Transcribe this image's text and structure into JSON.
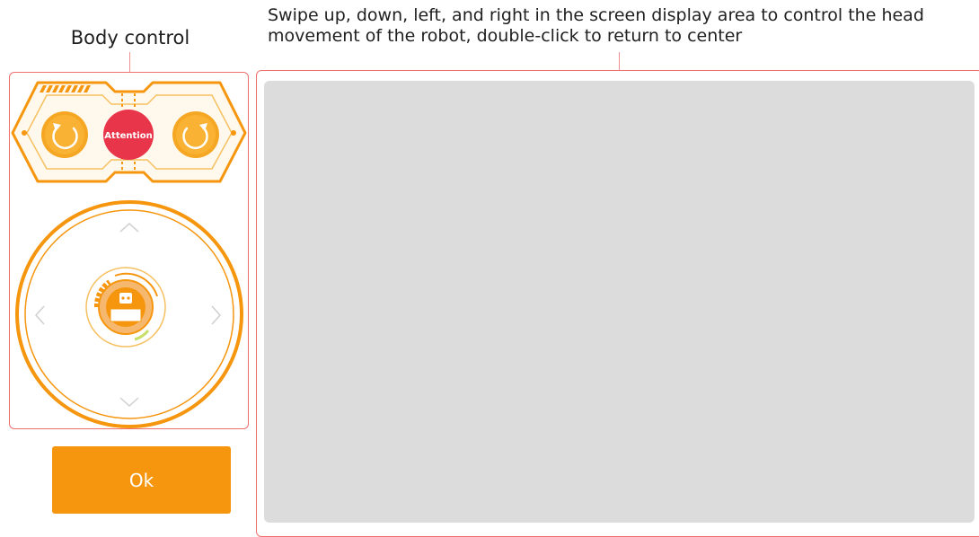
{
  "body_control": {
    "label": "Body control",
    "attention_label": "Attention"
  },
  "screen": {
    "instruction": "Swipe up, down, left, and right in the screen display area to control the head movement of the robot, double-click to return to center"
  },
  "actions": {
    "ok_label": "Ok"
  },
  "colors": {
    "accent_orange": "#f6960f",
    "attention_red": "#e8354a",
    "panel_border": "#f06f6f",
    "screen_background": "#dcdcdc"
  }
}
